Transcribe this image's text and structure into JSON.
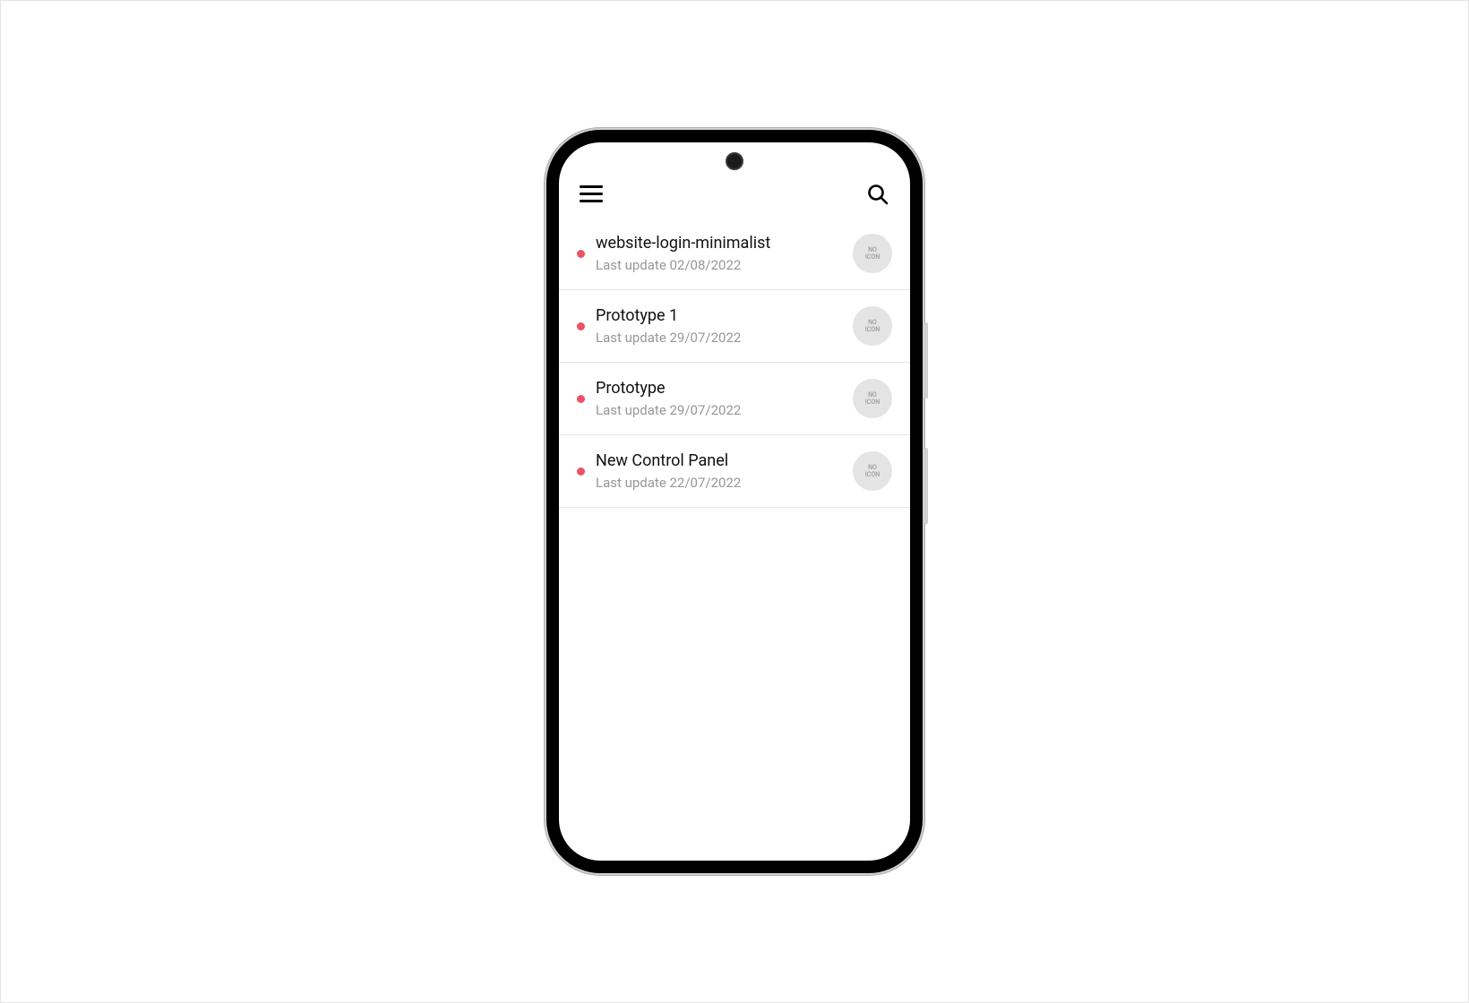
{
  "colors": {
    "status_dot": "#ef5066"
  },
  "thumbnail_placeholder": "NO\nICON",
  "items": [
    {
      "title": "website-login-minimalist",
      "subtitle": "Last update 02/08/2022"
    },
    {
      "title": "Prototype 1",
      "subtitle": "Last update 29/07/2022"
    },
    {
      "title": "Prototype",
      "subtitle": "Last update 29/07/2022"
    },
    {
      "title": "New Control Panel",
      "subtitle": "Last update 22/07/2022"
    }
  ]
}
